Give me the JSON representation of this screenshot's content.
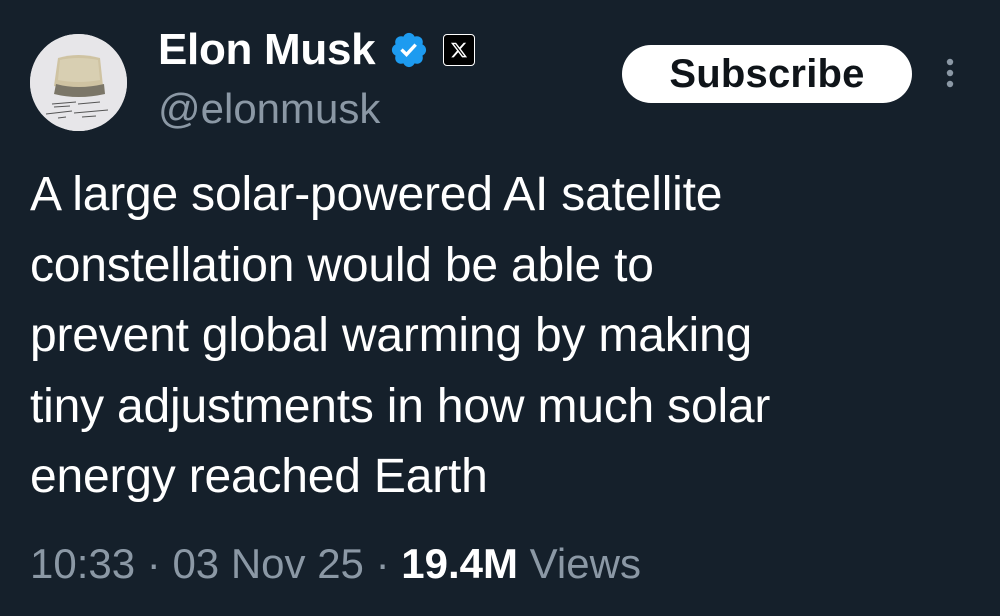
{
  "author": {
    "display_name": "Elon Musk",
    "handle": "@elonmusk",
    "verified_icon": "verified-badge-icon",
    "affiliation_icon": "x-logo-icon"
  },
  "actions": {
    "subscribe_label": "Subscribe",
    "more_icon": "more-vertical-icon"
  },
  "tweet": {
    "text": "A large solar-powered AI satellite\nconstellation would be able to\nprevent global warming by making\ntiny adjustments in how much solar\nenergy reached Earth"
  },
  "meta": {
    "time": "10:33",
    "separator": "·",
    "date": "03 Nov 25",
    "views_count": "19.4M",
    "views_label": "Views"
  },
  "colors": {
    "background": "#15202b",
    "text_primary": "#ffffff",
    "text_secondary": "#8b98a5",
    "verified_blue": "#1d9bf0"
  }
}
